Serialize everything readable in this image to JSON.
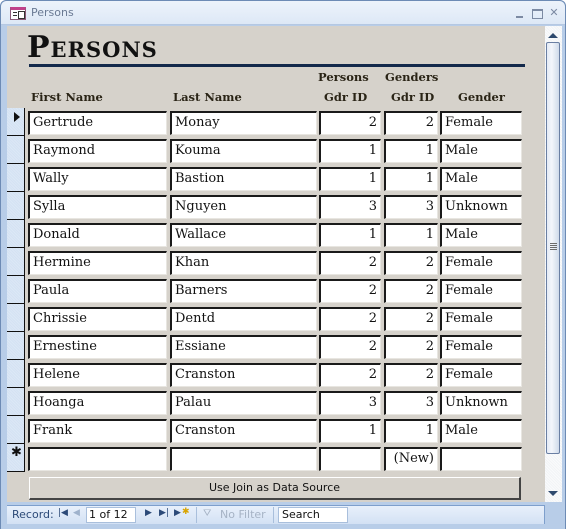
{
  "window": {
    "title": "Persons",
    "controls": {
      "minimize": "minimize",
      "maximize": "maximize",
      "close": "✕"
    }
  },
  "form": {
    "title": "Persons",
    "headers": {
      "first_name": "First Name",
      "last_name": "Last Name",
      "persons_gdr_id_line1": "Persons",
      "persons_gdr_id_line2": "Gdr ID",
      "genders_gdr_id_line1": "Genders",
      "genders_gdr_id_line2": "Gdr ID",
      "gender": "Gender"
    },
    "rows": [
      {
        "first": "Gertrude",
        "last": "Monay",
        "pid": "2",
        "gid": "2",
        "gender": "Female",
        "current": true
      },
      {
        "first": "Raymond",
        "last": "Kouma",
        "pid": "1",
        "gid": "1",
        "gender": "Male"
      },
      {
        "first": "Wally",
        "last": "Bastion",
        "pid": "1",
        "gid": "1",
        "gender": "Male"
      },
      {
        "first": "Sylla",
        "last": "Nguyen",
        "pid": "3",
        "gid": "3",
        "gender": "Unknown"
      },
      {
        "first": "Donald",
        "last": "Wallace",
        "pid": "1",
        "gid": "1",
        "gender": "Male"
      },
      {
        "first": "Hermine",
        "last": "Khan",
        "pid": "2",
        "gid": "2",
        "gender": "Female"
      },
      {
        "first": "Paula",
        "last": "Barners",
        "pid": "2",
        "gid": "2",
        "gender": "Female"
      },
      {
        "first": "Chrissie",
        "last": "Dentd",
        "pid": "2",
        "gid": "2",
        "gender": "Female"
      },
      {
        "first": "Ernestine",
        "last": "Essiane",
        "pid": "2",
        "gid": "2",
        "gender": "Female"
      },
      {
        "first": "Helene",
        "last": "Cranston",
        "pid": "2",
        "gid": "2",
        "gender": "Female"
      },
      {
        "first": "Hoanga",
        "last": "Palau",
        "pid": "3",
        "gid": "3",
        "gender": "Unknown"
      },
      {
        "first": "Frank",
        "last": "Cranston",
        "pid": "1",
        "gid": "1",
        "gender": "Male"
      }
    ],
    "new_row": {
      "first": "",
      "last": "",
      "pid": "",
      "gid": "(New)",
      "gender": "",
      "marker": "✱"
    },
    "join_button_label": "Use Join as Data Source"
  },
  "navigation": {
    "record_label": "Record:",
    "record_value": "1 of 12",
    "first_icon": "⏮",
    "prev_icon": "◀",
    "next_icon": "▶",
    "last_icon": "⏭",
    "filter_label": "No Filter",
    "search_placeholder": "Search"
  }
}
